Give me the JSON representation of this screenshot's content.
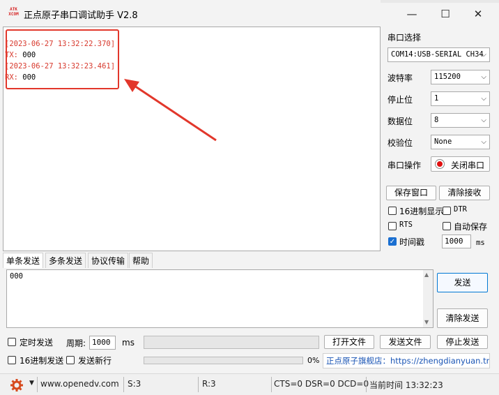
{
  "window": {
    "logo_text": "ATK\nXCOM",
    "title": "正点原子串口调试助手 V2.8",
    "minimize_glyph": "—",
    "maximize_glyph": "☐",
    "close_glyph": "✕"
  },
  "receive_log": [
    {
      "text": "[2023-06-27 13:32:22.370]",
      "color": "#d7372b"
    },
    {
      "prefix": "TX:",
      "text": " 000"
    },
    {
      "text": "[2023-06-27 13:32:23.461]",
      "color": "#d7372b"
    },
    {
      "prefix": "RX:",
      "text": " 000"
    }
  ],
  "annotation": {
    "color": "#e2372b"
  },
  "settings": {
    "port_select_label": "串口选择",
    "port_value": "COM14:USB-SERIAL CH34",
    "baud_label": "波特率",
    "baud_value": "115200",
    "stop_label": "停止位",
    "stop_value": "1",
    "data_label": "数据位",
    "data_value": "8",
    "parity_label": "校验位",
    "parity_value": "None",
    "op_label": "串口操作",
    "close_port_button": "关闭串口",
    "save_window_button": "保存窗口",
    "clear_receive_button": "清除接收",
    "hex_display_label": "16进制显示",
    "hex_display_checked": false,
    "dtr_label": "DTR",
    "dtr_checked": false,
    "rts_label": "RTS",
    "rts_checked": false,
    "auto_save_label": "自动保存",
    "auto_save_checked": false,
    "timestamp_label": "时间戳",
    "timestamp_checked": true,
    "timestamp_ms_value": "1000",
    "timestamp_ms_unit": "ms"
  },
  "tabs": [
    {
      "label": "单条发送",
      "active": true
    },
    {
      "label": "多条发送",
      "active": false
    },
    {
      "label": "协议传输",
      "active": false
    },
    {
      "label": "帮助",
      "active": false
    }
  ],
  "send": {
    "text": "000",
    "send_button": "发送",
    "clear_send_button": "清除发送",
    "timed_send_label": "定时发送",
    "timed_send_checked": false,
    "period_label": "周期:",
    "period_value": "1000",
    "period_unit": "ms",
    "open_file_button": "打开文件",
    "send_file_button": "发送文件",
    "stop_send_button": "停止发送",
    "hex_send_label": "16进制发送",
    "hex_send_checked": false,
    "newline_label": "发送新行",
    "newline_checked": false,
    "progress_percent": "0%",
    "progress_fraction": 0,
    "store_link": "正点原子旗舰店：https://zhengdianyuan.tmall.com"
  },
  "status": {
    "website": "www.openedv.com",
    "sent": "S:3",
    "received": "R:3",
    "lines": "CTS=0 DSR=0 DCD=0",
    "time": "当前时间 13:32:23"
  }
}
